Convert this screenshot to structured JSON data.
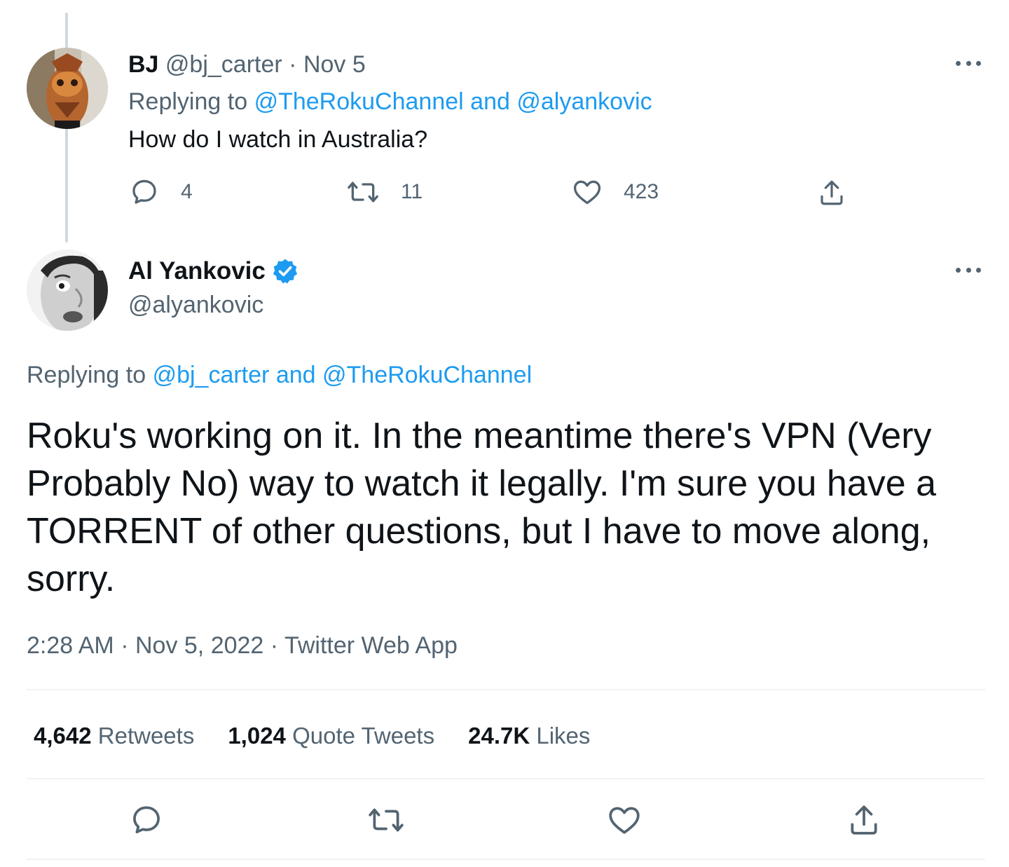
{
  "parent_tweet": {
    "display_name": "BJ",
    "handle": "@bj_carter",
    "separator": "·",
    "date": "Nov 5",
    "replying_prefix": "Replying to",
    "replying_to_1": "@TheRokuChannel",
    "replying_and": "and",
    "replying_to_2": "@alyankovic",
    "text": "How do I watch in Australia?",
    "actions": {
      "reply_count": "4",
      "retweet_count": "11",
      "like_count": "423"
    },
    "icons": [
      "reply-icon",
      "retweet-icon",
      "like-icon",
      "share-icon",
      "more-icon"
    ]
  },
  "main_tweet": {
    "display_name": "Al Yankovic",
    "verified_icon": "verified-badge-icon",
    "handle": "@alyankovic",
    "replying_prefix": "Replying to",
    "replying_to_1": "@bj_carter",
    "replying_and": "and",
    "replying_to_2": "@TheRokuChannel",
    "text": "Roku's working on it. In the meantime there's VPN (Very Probably No) way to watch it legally. I'm sure you have a TORRENT of other questions, but I have to move along, sorry.",
    "time": "2:28 AM",
    "separator": "·",
    "date": "Nov 5, 2022",
    "source": "Twitter Web App",
    "stats": {
      "retweets_value": "4,642",
      "retweets_label": "Retweets",
      "quotes_value": "1,024",
      "quotes_label": "Quote Tweets",
      "likes_value": "24.7K",
      "likes_label": "Likes"
    }
  },
  "colors": {
    "link": "#1d9bf0",
    "secondary_text": "#536471",
    "primary_text": "#0f1419",
    "thread_line": "#cfd9de",
    "divider": "#eff3f4"
  }
}
